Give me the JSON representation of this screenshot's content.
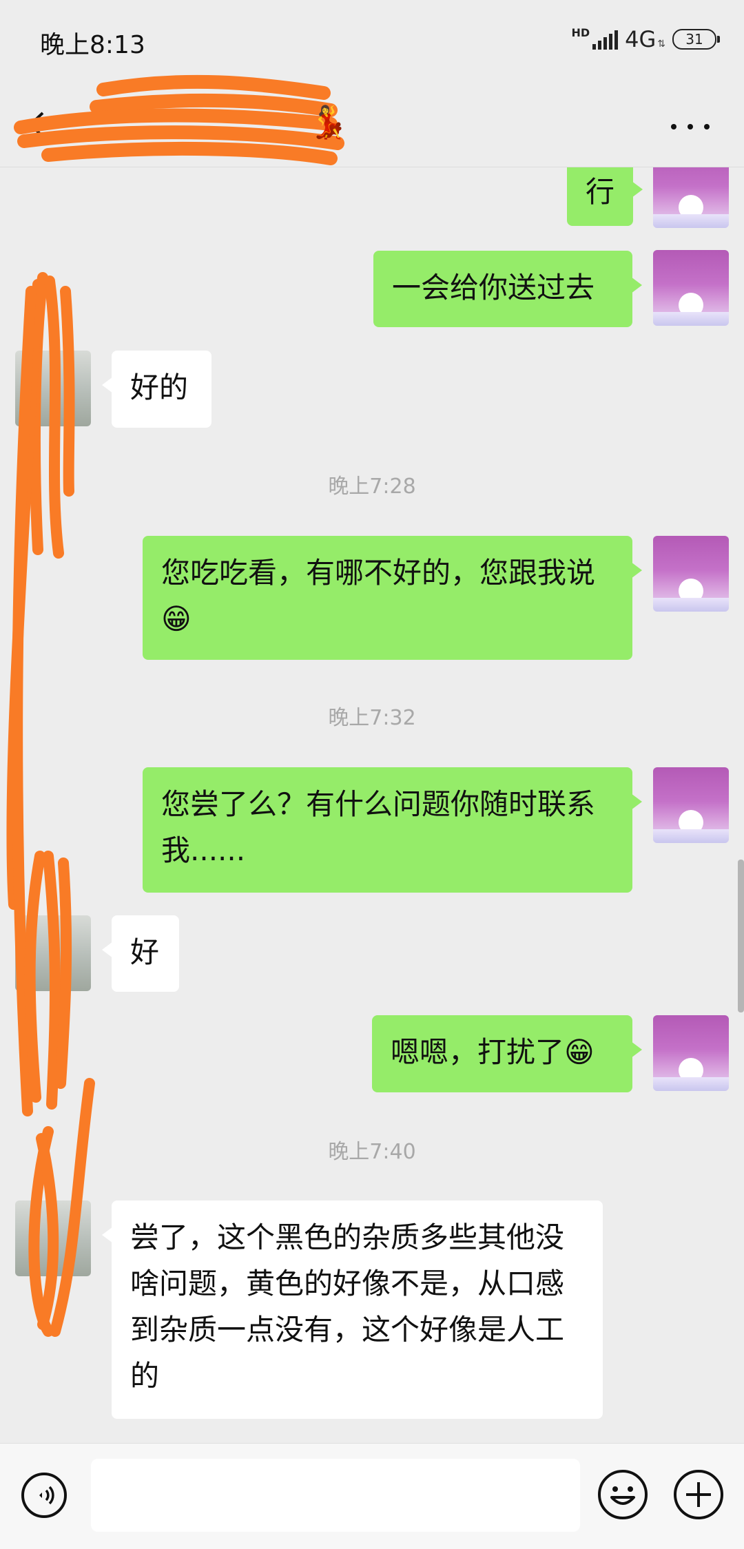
{
  "status_bar": {
    "time": "晚上8:13",
    "hd": "HD",
    "network": "4G",
    "battery": "31"
  },
  "header": {
    "title": "",
    "more_icon": "ellipsis-icon",
    "back_icon": "back-arrow-icon"
  },
  "messages": [
    {
      "from": "self",
      "text": "行"
    },
    {
      "from": "self",
      "text": "一会给你送过去"
    },
    {
      "from": "other",
      "text": "好的"
    },
    {
      "type": "time",
      "text": "晚上7:28"
    },
    {
      "from": "self",
      "text": "您吃吃看，有哪不好的，您跟我说",
      "emoji": "😁"
    },
    {
      "type": "time",
      "text": "晚上7:32"
    },
    {
      "from": "self",
      "text": "您尝了么？有什么问题你随时联系我......"
    },
    {
      "from": "other",
      "text": "好"
    },
    {
      "from": "self",
      "text": "嗯嗯，打扰了",
      "emoji": "😁"
    },
    {
      "type": "time",
      "text": "晚上7:40"
    },
    {
      "from": "other",
      "text": "尝了，这个黑色的杂质多些其他没啥问题，黄色的好像不是，从口感到杂质一点没有，这个好像是人工的"
    }
  ],
  "input_bar": {
    "voice_icon": "voice-icon",
    "text_value": "",
    "emoji_icon": "emoji-icon",
    "plus_icon": "plus-icon"
  },
  "colors": {
    "background": "#ededed",
    "outgoing_bubble": "#95ec69",
    "incoming_bubble": "#ffffff",
    "redaction": "#f97b26"
  }
}
